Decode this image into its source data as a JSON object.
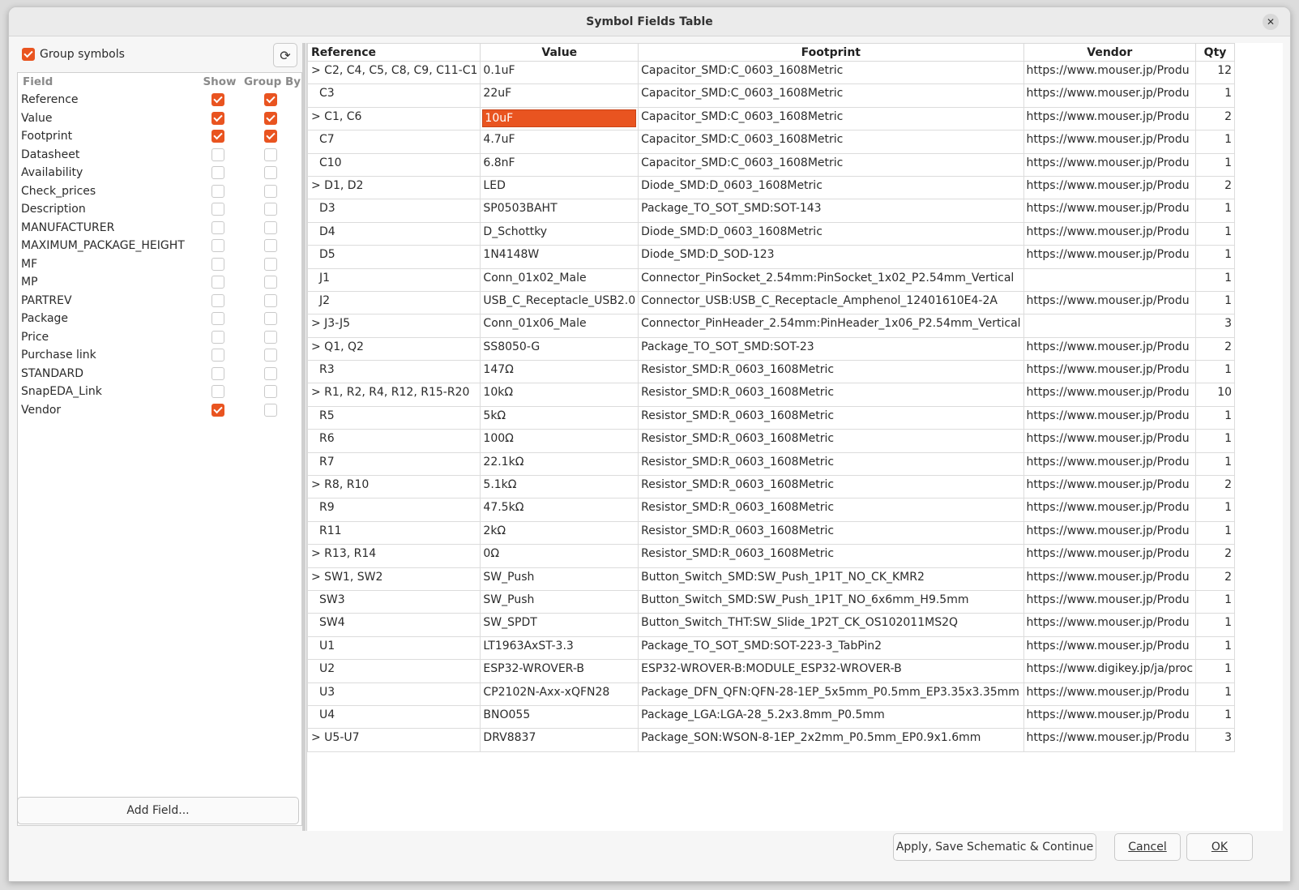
{
  "window": {
    "title": "Symbol Fields Table"
  },
  "left": {
    "group_symbols_label": "Group symbols",
    "group_symbols_checked": true,
    "headers": {
      "field": "Field",
      "show": "Show",
      "group_by": "Group By"
    },
    "fields": [
      {
        "name": "Reference",
        "show": true,
        "group": true
      },
      {
        "name": "Value",
        "show": true,
        "group": true
      },
      {
        "name": "Footprint",
        "show": true,
        "group": true
      },
      {
        "name": "Datasheet",
        "show": false,
        "group": false
      },
      {
        "name": "Availability",
        "show": false,
        "group": false
      },
      {
        "name": "Check_prices",
        "show": false,
        "group": false
      },
      {
        "name": "Description",
        "show": false,
        "group": false
      },
      {
        "name": "MANUFACTURER",
        "show": false,
        "group": false
      },
      {
        "name": "MAXIMUM_PACKAGE_HEIGHT",
        "show": false,
        "group": false
      },
      {
        "name": "MF",
        "show": false,
        "group": false
      },
      {
        "name": "MP",
        "show": false,
        "group": false
      },
      {
        "name": "PARTREV",
        "show": false,
        "group": false
      },
      {
        "name": "Package",
        "show": false,
        "group": false
      },
      {
        "name": "Price",
        "show": false,
        "group": false
      },
      {
        "name": "Purchase link",
        "show": false,
        "group": false
      },
      {
        "name": "STANDARD",
        "show": false,
        "group": false
      },
      {
        "name": "SnapEDA_Link",
        "show": false,
        "group": false
      },
      {
        "name": "Vendor",
        "show": true,
        "group": false
      }
    ],
    "add_field_label": "Add Field..."
  },
  "table": {
    "columns": [
      "Reference",
      "Value",
      "Footprint",
      "Vendor",
      "Qty"
    ],
    "rows": [
      [
        "> C2, C4, C5, C8, C9, C11-C1",
        "0.1uF",
        "Capacitor_SMD:C_0603_1608Metric",
        "https://www.mouser.jp/Produ",
        "12"
      ],
      [
        "C3",
        "22uF",
        "Capacitor_SMD:C_0603_1608Metric",
        "https://www.mouser.jp/Produ",
        "1"
      ],
      [
        "> C1, C6",
        "10uF",
        "Capacitor_SMD:C_0603_1608Metric",
        "https://www.mouser.jp/Produ",
        "2"
      ],
      [
        "C7",
        "4.7uF",
        "Capacitor_SMD:C_0603_1608Metric",
        "https://www.mouser.jp/Produ",
        "1"
      ],
      [
        "C10",
        "6.8nF",
        "Capacitor_SMD:C_0603_1608Metric",
        "https://www.mouser.jp/Produ",
        "1"
      ],
      [
        "> D1, D2",
        "LED",
        "Diode_SMD:D_0603_1608Metric",
        "https://www.mouser.jp/Produ",
        "2"
      ],
      [
        "D3",
        "SP0503BAHT",
        "Package_TO_SOT_SMD:SOT-143",
        "https://www.mouser.jp/Produ",
        "1"
      ],
      [
        "D4",
        "D_Schottky",
        "Diode_SMD:D_0603_1608Metric",
        "https://www.mouser.jp/Produ",
        "1"
      ],
      [
        "D5",
        "1N4148W",
        "Diode_SMD:D_SOD-123",
        "https://www.mouser.jp/Produ",
        "1"
      ],
      [
        "J1",
        "Conn_01x02_Male",
        "Connector_PinSocket_2.54mm:PinSocket_1x02_P2.54mm_Vertical",
        "",
        "1"
      ],
      [
        "J2",
        "USB_C_Receptacle_USB2.0",
        "Connector_USB:USB_C_Receptacle_Amphenol_12401610E4-2A",
        "https://www.mouser.jp/Produ",
        "1"
      ],
      [
        "> J3-J5",
        "Conn_01x06_Male",
        "Connector_PinHeader_2.54mm:PinHeader_1x06_P2.54mm_Vertical",
        "",
        "3"
      ],
      [
        "> Q1, Q2",
        "SS8050-G",
        "Package_TO_SOT_SMD:SOT-23",
        "https://www.mouser.jp/Produ",
        "2"
      ],
      [
        "R3",
        "147Ω",
        "Resistor_SMD:R_0603_1608Metric",
        "https://www.mouser.jp/Produ",
        "1"
      ],
      [
        "> R1, R2, R4, R12, R15-R20",
        "10kΩ",
        "Resistor_SMD:R_0603_1608Metric",
        "https://www.mouser.jp/Produ",
        "10"
      ],
      [
        "R5",
        "5kΩ",
        "Resistor_SMD:R_0603_1608Metric",
        "https://www.mouser.jp/Produ",
        "1"
      ],
      [
        "R6",
        "100Ω",
        "Resistor_SMD:R_0603_1608Metric",
        "https://www.mouser.jp/Produ",
        "1"
      ],
      [
        "R7",
        "22.1kΩ",
        "Resistor_SMD:R_0603_1608Metric",
        "https://www.mouser.jp/Produ",
        "1"
      ],
      [
        "> R8, R10",
        "5.1kΩ",
        "Resistor_SMD:R_0603_1608Metric",
        "https://www.mouser.jp/Produ",
        "2"
      ],
      [
        "R9",
        "47.5kΩ",
        "Resistor_SMD:R_0603_1608Metric",
        "https://www.mouser.jp/Produ",
        "1"
      ],
      [
        "R11",
        "2kΩ",
        "Resistor_SMD:R_0603_1608Metric",
        "https://www.mouser.jp/Produ",
        "1"
      ],
      [
        "> R13, R14",
        "0Ω",
        "Resistor_SMD:R_0603_1608Metric",
        "https://www.mouser.jp/Produ",
        "2"
      ],
      [
        "> SW1, SW2",
        "SW_Push",
        "Button_Switch_SMD:SW_Push_1P1T_NO_CK_KMR2",
        "https://www.mouser.jp/Produ",
        "2"
      ],
      [
        "SW3",
        "SW_Push",
        "Button_Switch_SMD:SW_Push_1P1T_NO_6x6mm_H9.5mm",
        "https://www.mouser.jp/Produ",
        "1"
      ],
      [
        "SW4",
        "SW_SPDT",
        "Button_Switch_THT:SW_Slide_1P2T_CK_OS102011MS2Q",
        "https://www.mouser.jp/Produ",
        "1"
      ],
      [
        "U1",
        "LT1963AxST-3.3",
        "Package_TO_SOT_SMD:SOT-223-3_TabPin2",
        "https://www.mouser.jp/Produ",
        "1"
      ],
      [
        "U2",
        "ESP32-WROVER-B",
        "ESP32-WROVER-B:MODULE_ESP32-WROVER-B",
        "https://www.digikey.jp/ja/proc",
        "1"
      ],
      [
        "U3",
        "CP2102N-Axx-xQFN28",
        "Package_DFN_QFN:QFN-28-1EP_5x5mm_P0.5mm_EP3.35x3.35mm",
        "https://www.mouser.jp/Produ",
        "1"
      ],
      [
        "U4",
        "BNO055",
        "Package_LGA:LGA-28_5.2x3.8mm_P0.5mm",
        "https://www.mouser.jp/Produ",
        "1"
      ],
      [
        "> U5-U7",
        "DRV8837",
        "Package_SON:WSON-8-1EP_2x2mm_P0.5mm_EP0.9x1.6mm",
        "https://www.mouser.jp/Produ",
        "3"
      ]
    ],
    "selected_cell": {
      "row": 2,
      "col": 1
    }
  },
  "buttons": {
    "apply": "Apply, Save Schematic & Continue",
    "cancel": "Cancel",
    "ok": "OK"
  },
  "colors": {
    "accent": "#e95420"
  },
  "icons": {
    "close": "close-icon",
    "refresh": "refresh-icon"
  }
}
